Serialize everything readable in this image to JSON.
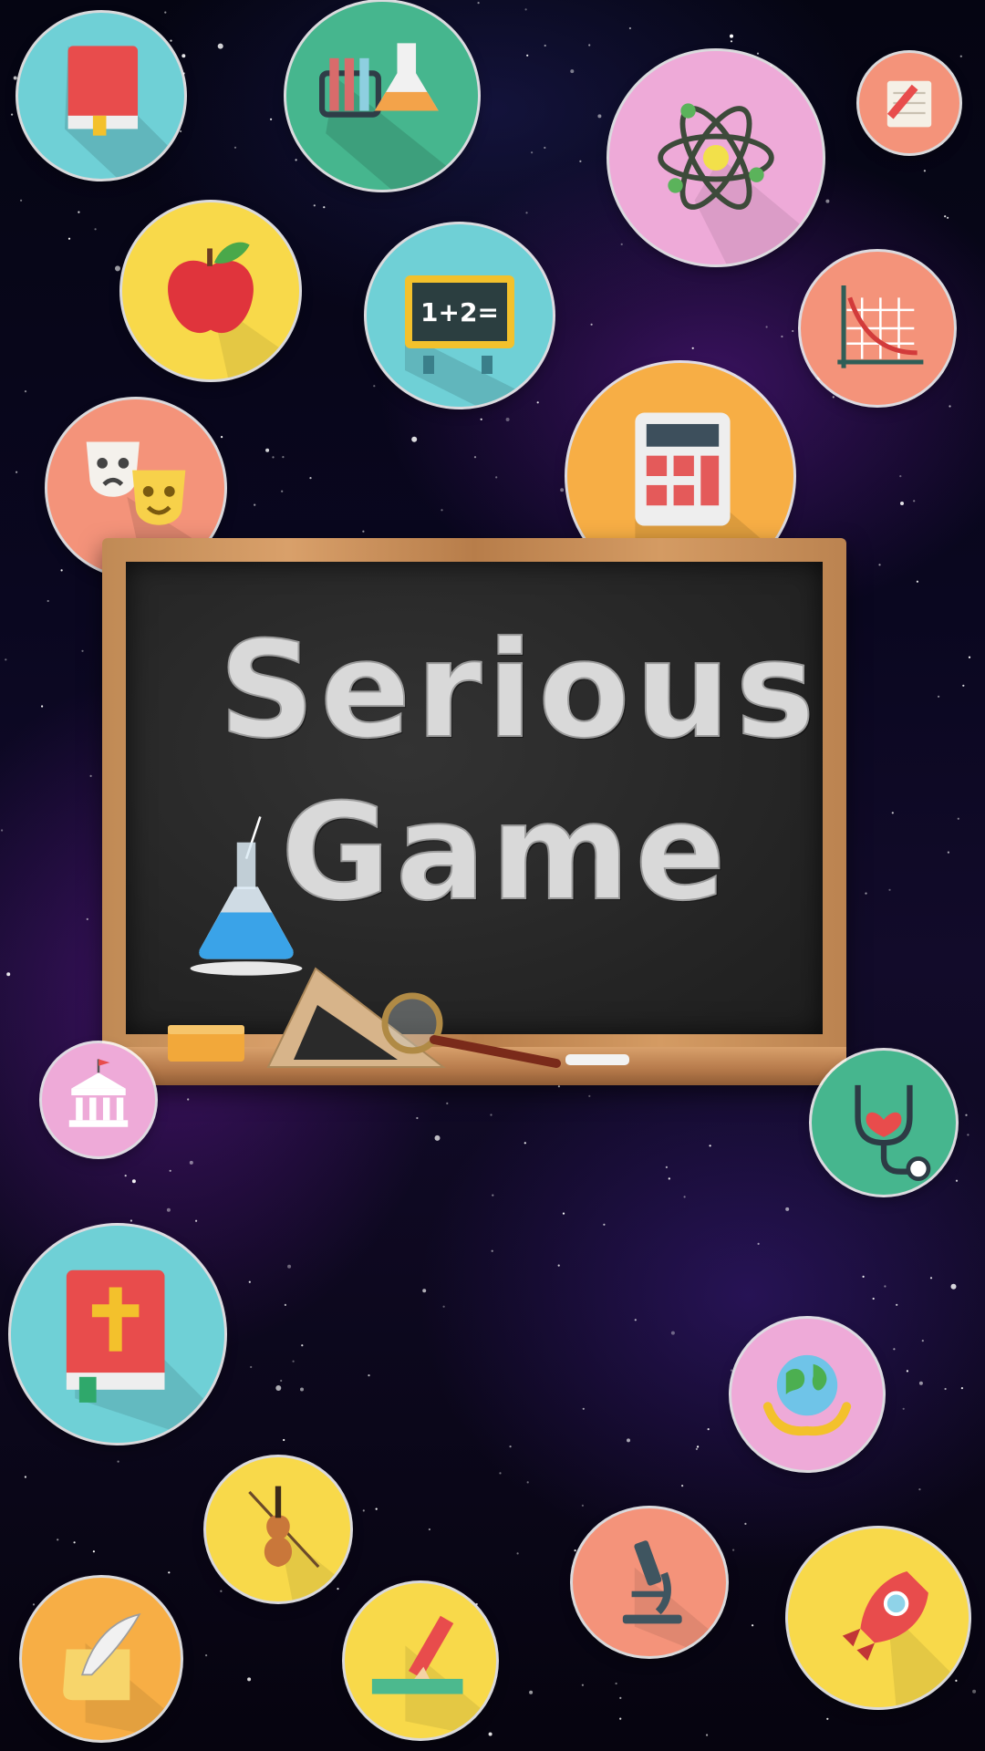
{
  "app": {
    "title_line1": "Serious",
    "title_line2": "Game"
  },
  "colors": {
    "teal": "#6fd0d6",
    "yellow": "#f8d94a",
    "pink": "#eeaad8",
    "salmon": "#f4937a",
    "orange": "#f7ae45",
    "green": "#46b68e",
    "chalk": "#d9d9d9"
  },
  "icons": [
    {
      "name": "book-icon",
      "color": "teal"
    },
    {
      "name": "chemistry-tubes-icon",
      "color": "green"
    },
    {
      "name": "atom-icon",
      "color": "pink"
    },
    {
      "name": "notebook-pencil-icon",
      "color": "salmon"
    },
    {
      "name": "apple-icon",
      "color": "yellow"
    },
    {
      "name": "math-board-icon",
      "color": "teal"
    },
    {
      "name": "graph-icon",
      "color": "salmon"
    },
    {
      "name": "theater-masks-icon",
      "color": "salmon"
    },
    {
      "name": "calculator-icon",
      "color": "orange"
    },
    {
      "name": "museum-icon",
      "color": "pink"
    },
    {
      "name": "stethoscope-icon",
      "color": "green"
    },
    {
      "name": "bible-icon",
      "color": "teal"
    },
    {
      "name": "earth-hands-icon",
      "color": "pink"
    },
    {
      "name": "violin-icon",
      "color": "yellow"
    },
    {
      "name": "microscope-icon",
      "color": "salmon"
    },
    {
      "name": "rocket-icon",
      "color": "yellow"
    },
    {
      "name": "quill-scroll-icon",
      "color": "orange"
    },
    {
      "name": "pencil-ruler-icon",
      "color": "yellow"
    }
  ],
  "board_icons": [
    {
      "name": "flask-icon"
    }
  ]
}
